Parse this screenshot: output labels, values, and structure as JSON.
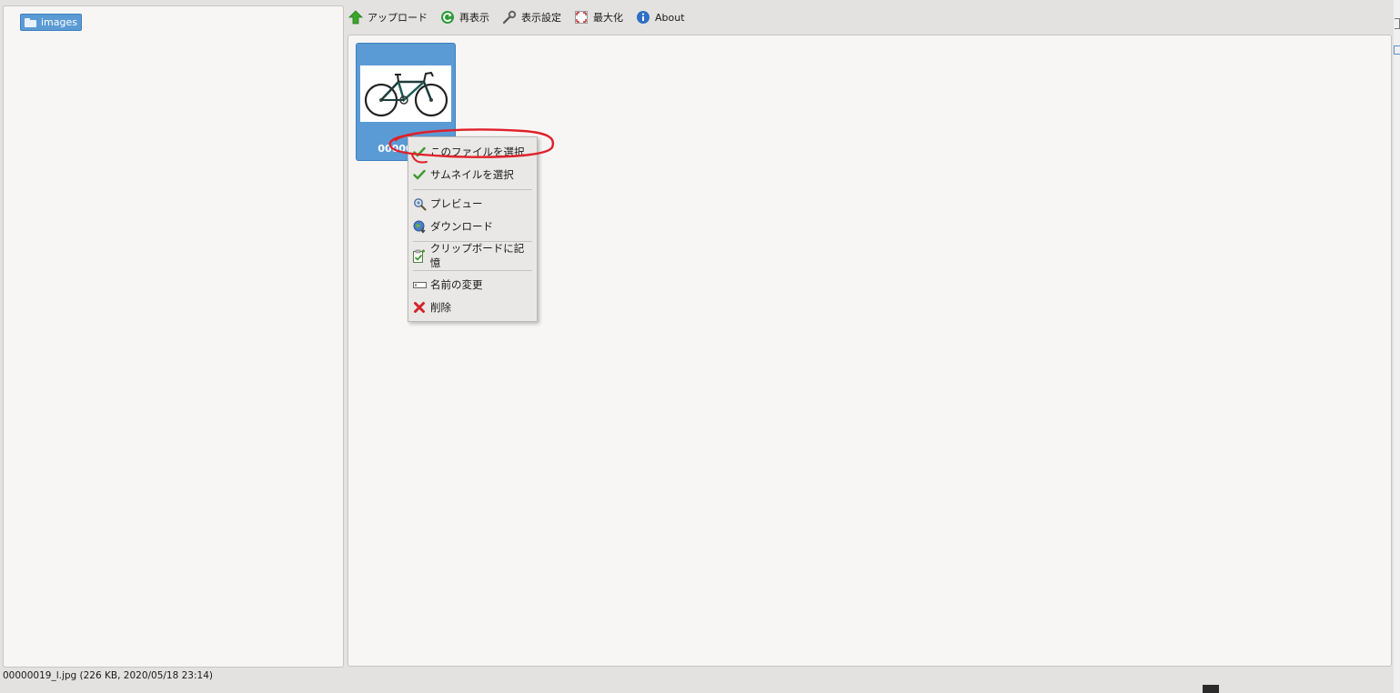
{
  "sidebar": {
    "folder_label": "images"
  },
  "toolbar": {
    "upload": "アップロード",
    "refresh": "再表示",
    "settings": "表示設定",
    "maximize": "最大化",
    "about": "About"
  },
  "file": {
    "thumbnail_label": "00000019_l.jpg",
    "thumbnail_visible": "00000019",
    "thumbnail_alt": "road bicycle"
  },
  "context_menu": {
    "items": [
      {
        "label": "このファイルを選択",
        "icon": "green-check-icon"
      },
      {
        "label": "サムネイルを選択",
        "icon": "green-check-icon"
      },
      {
        "label": "プレビュー",
        "icon": "magnifier-icon"
      },
      {
        "label": "ダウンロード",
        "icon": "globe-download-icon"
      },
      {
        "label": "クリップボードに記憶",
        "icon": "clipboard-icon"
      },
      {
        "label": "名前の変更",
        "icon": "rename-field-icon"
      },
      {
        "label": "削除",
        "icon": "red-x-icon"
      }
    ]
  },
  "status_bar": {
    "text": "00000019_l.jpg (226 KB, 2020/05/18 23:14)"
  },
  "colors": {
    "selection_blue": "#5b9bd5",
    "annotation_red": "#e0202a",
    "pane_bg": "#f7f6f5",
    "window_bg": "#e3e2e0"
  }
}
